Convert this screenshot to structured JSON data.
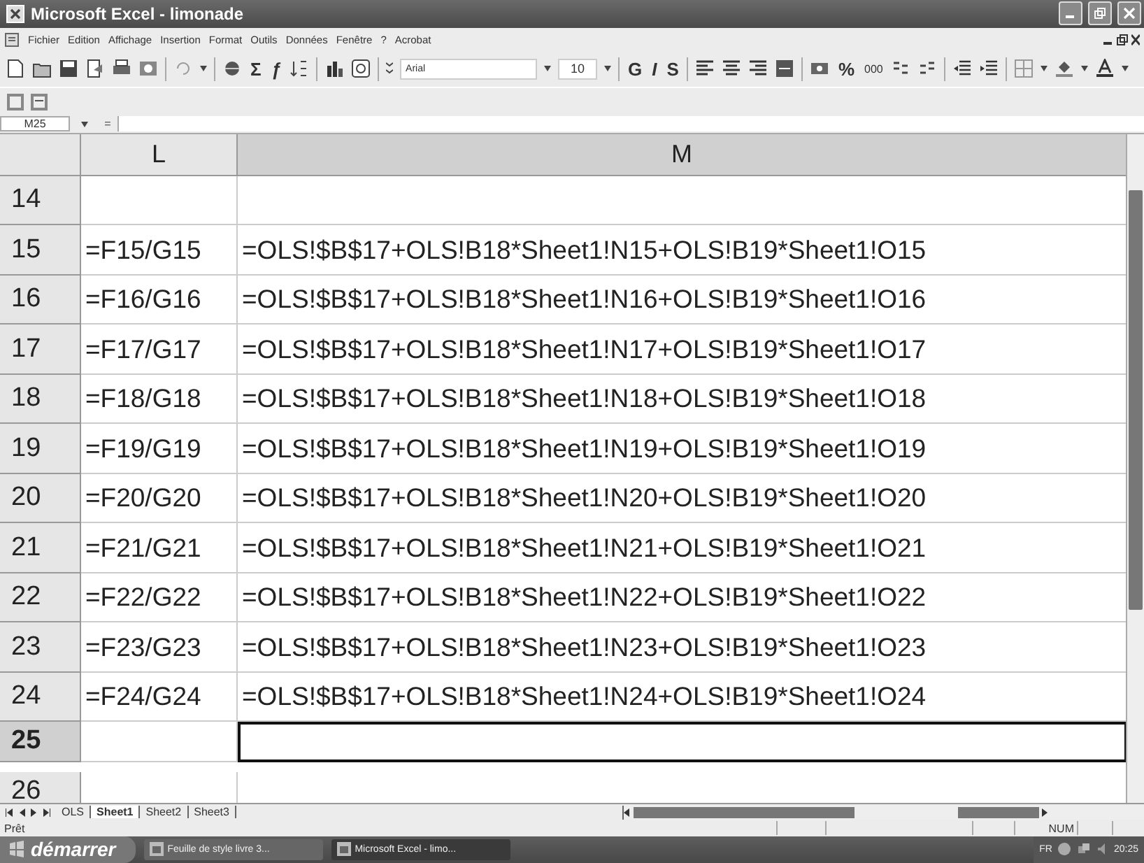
{
  "window": {
    "title": "Microsoft Excel - limonade"
  },
  "menu": [
    "Fichier",
    "Edition",
    "Affichage",
    "Insertion",
    "Format",
    "Outils",
    "Données",
    "Fenêtre",
    "?",
    "Acrobat"
  ],
  "toolbar": {
    "font": "Arial",
    "size": "10",
    "glyph_buttons": [
      "Σ",
      "ƒ",
      "G",
      "I",
      "S",
      "%",
      "000"
    ]
  },
  "formula_bar": {
    "name_box": "M25",
    "equals": "="
  },
  "columns": [
    {
      "label": "L",
      "selected": false
    },
    {
      "label": "M",
      "selected": true
    }
  ],
  "rows": [
    {
      "number": "14",
      "selected": false
    },
    {
      "number": "15",
      "selected": false,
      "cells": [
        "=F15/G15",
        "=OLS!$B$17+OLS!B18*Sheet1!N15+OLS!B19*Sheet1!O15"
      ]
    },
    {
      "number": "16",
      "selected": false,
      "cells": [
        "=F16/G16",
        "=OLS!$B$17+OLS!B18*Sheet1!N16+OLS!B19*Sheet1!O16"
      ]
    },
    {
      "number": "17",
      "selected": false,
      "cells": [
        "=F17/G17",
        "=OLS!$B$17+OLS!B18*Sheet1!N17+OLS!B19*Sheet1!O17"
      ]
    },
    {
      "number": "18",
      "selected": false,
      "cells": [
        "=F18/G18",
        "=OLS!$B$17+OLS!B18*Sheet1!N18+OLS!B19*Sheet1!O18"
      ]
    },
    {
      "number": "19",
      "selected": false,
      "cells": [
        "=F19/G19",
        "=OLS!$B$17+OLS!B18*Sheet1!N19+OLS!B19*Sheet1!O19"
      ]
    },
    {
      "number": "20",
      "selected": false,
      "cells": [
        "=F20/G20",
        "=OLS!$B$17+OLS!B18*Sheet1!N20+OLS!B19*Sheet1!O20"
      ]
    },
    {
      "number": "21",
      "selected": false,
      "cells": [
        "=F21/G21",
        "=OLS!$B$17+OLS!B18*Sheet1!N21+OLS!B19*Sheet1!O21"
      ]
    },
    {
      "number": "22",
      "selected": false,
      "cells": [
        "=F22/G22",
        "=OLS!$B$17+OLS!B18*Sheet1!N22+OLS!B19*Sheet1!O22"
      ]
    },
    {
      "number": "23",
      "selected": false,
      "cells": [
        "=F23/G23",
        "=OLS!$B$17+OLS!B18*Sheet1!N23+OLS!B19*Sheet1!O23"
      ]
    },
    {
      "number": "24",
      "selected": false,
      "cells": [
        "=F24/G24",
        "=OLS!$B$17+OLS!B18*Sheet1!N24+OLS!B19*Sheet1!O24"
      ]
    },
    {
      "number": "25",
      "selected": true
    },
    {
      "number": "26",
      "selected": false
    }
  ],
  "sheet_tabs": [
    {
      "label": "OLS",
      "selected": false
    },
    {
      "label": "Sheet1",
      "selected": true
    },
    {
      "label": "Sheet2",
      "selected": false
    },
    {
      "label": "Sheet3",
      "selected": false
    }
  ],
  "status_bar": {
    "text": "Prêt",
    "indicator": "NUM"
  },
  "taskbar": {
    "start": "démarrer",
    "tasks": [
      {
        "label": "Feuille de style livre 3...",
        "selected": false
      },
      {
        "label": "Microsoft Excel - limo...",
        "selected": true
      }
    ],
    "language": "FR",
    "clock": "20:25"
  }
}
